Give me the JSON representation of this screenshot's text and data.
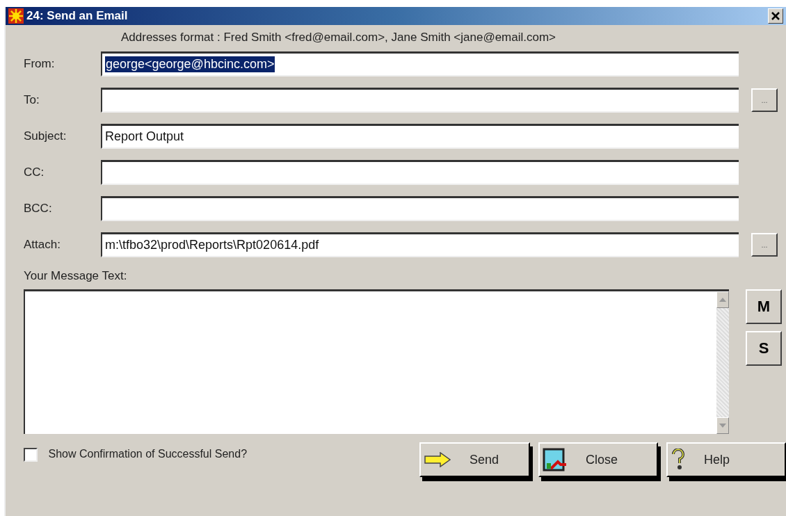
{
  "window": {
    "title": "24: Send an Email"
  },
  "format_hint": "Addresses format : Fred Smith <fred@email.com>, Jane Smith <jane@email.com>",
  "fields": [
    {
      "label": "From:",
      "value": "george<george@hbcinc.com>",
      "selected": true
    },
    {
      "label": "To:",
      "browse_button": "..."
    },
    {
      "label": "Subject:",
      "value": "Report Output"
    },
    {
      "label": "CC:"
    },
    {
      "label": "BCC:"
    },
    {
      "label": "Attach:",
      "value": "m:\\tfbo32\\prod\\Reports\\Rpt020614.pdf",
      "browse_button": "..."
    }
  ],
  "message": {
    "label": "Your Message Text:"
  },
  "side_buttons": [
    {
      "label": "M"
    },
    {
      "label": "S"
    }
  ],
  "confirmation": {
    "label": "Show Confirmation of Successful Send?",
    "checked": false
  },
  "buttons": [
    {
      "kind": "send",
      "label": "Send"
    },
    {
      "kind": "close",
      "label": "Close"
    },
    {
      "kind": "help",
      "label": "Help"
    }
  ]
}
